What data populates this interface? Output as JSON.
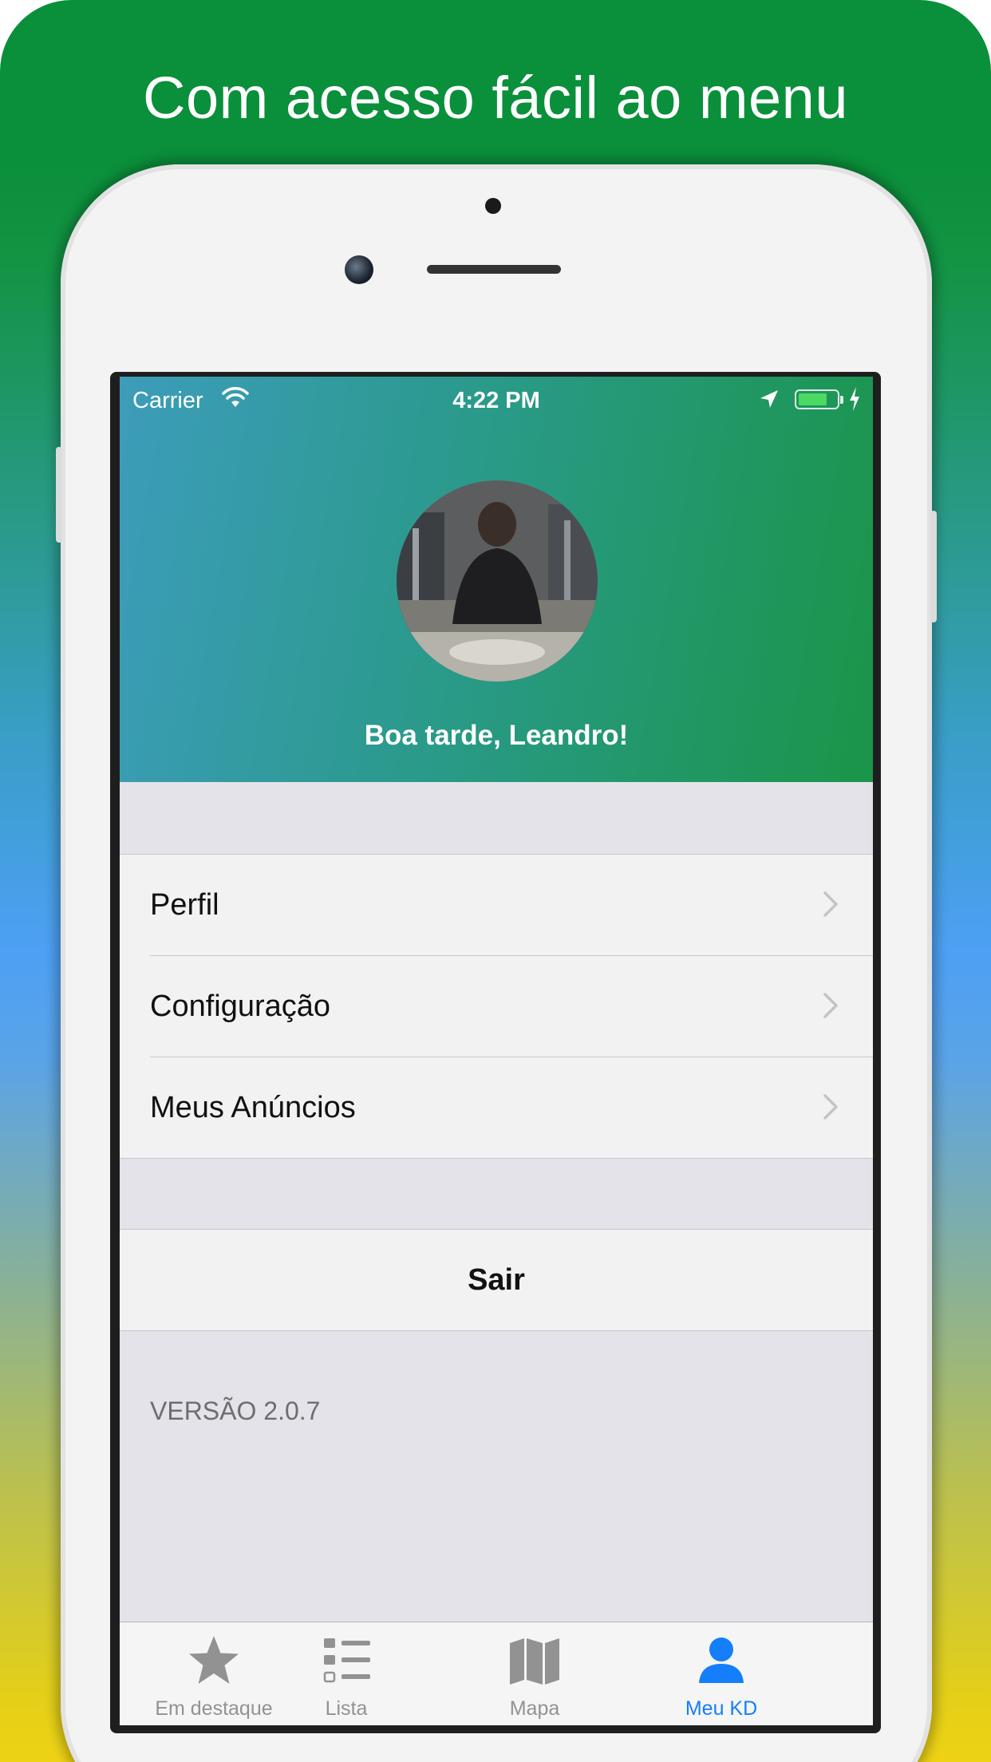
{
  "headline": "Com acesso fácil ao menu",
  "status_bar": {
    "carrier": "Carrier",
    "time": "4:22 PM",
    "battery_level": 0.75
  },
  "profile": {
    "greeting": "Boa tarde, Leandro!"
  },
  "menu": {
    "items": [
      {
        "label": "Perfil"
      },
      {
        "label": "Configuração"
      },
      {
        "label": "Meus Anúncios"
      }
    ],
    "logout_label": "Sair"
  },
  "version_text": "VERSÃO 2.0.7",
  "tab_bar": {
    "tabs": [
      {
        "label": "Em destaque",
        "icon": "star-icon",
        "active": false
      },
      {
        "label": "Lista",
        "icon": "list-icon",
        "active": false
      },
      {
        "label": "Mapa",
        "icon": "map-icon",
        "active": false
      },
      {
        "label": "Meu KD",
        "icon": "person-icon",
        "active": true
      }
    ]
  },
  "colors": {
    "accent": "#147efb",
    "header_start": "#3d9cbb",
    "header_end": "#1a9548",
    "inactive_tab": "#929292"
  }
}
